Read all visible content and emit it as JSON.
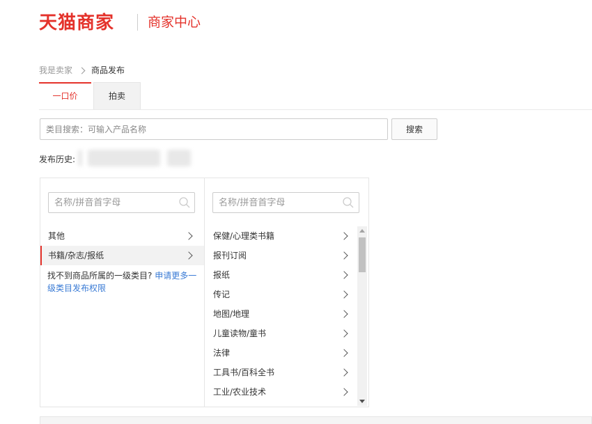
{
  "header": {
    "logo_text": "天猫商家",
    "center_title": "商家中心",
    "brand_color": "#e4322b"
  },
  "breadcrumb": {
    "parent": "我是卖家",
    "current": "商品发布"
  },
  "tabs": [
    {
      "label": "一口价",
      "active": true
    },
    {
      "label": "拍卖",
      "active": false
    }
  ],
  "category_search": {
    "placeholder": "类目搜索：可输入产品名称",
    "button_label": "搜索"
  },
  "history": {
    "label": "发布历史:"
  },
  "level1": {
    "filter_placeholder": "名称/拼音首字母",
    "items": [
      {
        "label": "其他",
        "selected": false
      },
      {
        "label": "书籍/杂志/报纸",
        "selected": true
      }
    ],
    "hint_text": "找不到商品所属的一级类目?",
    "hint_link": "申请更多一级类目发布权限"
  },
  "level2": {
    "filter_placeholder": "名称/拼音首字母",
    "items": [
      {
        "label": "保健/心理类书籍"
      },
      {
        "label": "报刊订阅"
      },
      {
        "label": "报纸"
      },
      {
        "label": "传记"
      },
      {
        "label": "地图/地理"
      },
      {
        "label": "儿童读物/童书"
      },
      {
        "label": "法律"
      },
      {
        "label": "工具书/百科全书"
      },
      {
        "label": "工业/农业技术"
      }
    ]
  }
}
